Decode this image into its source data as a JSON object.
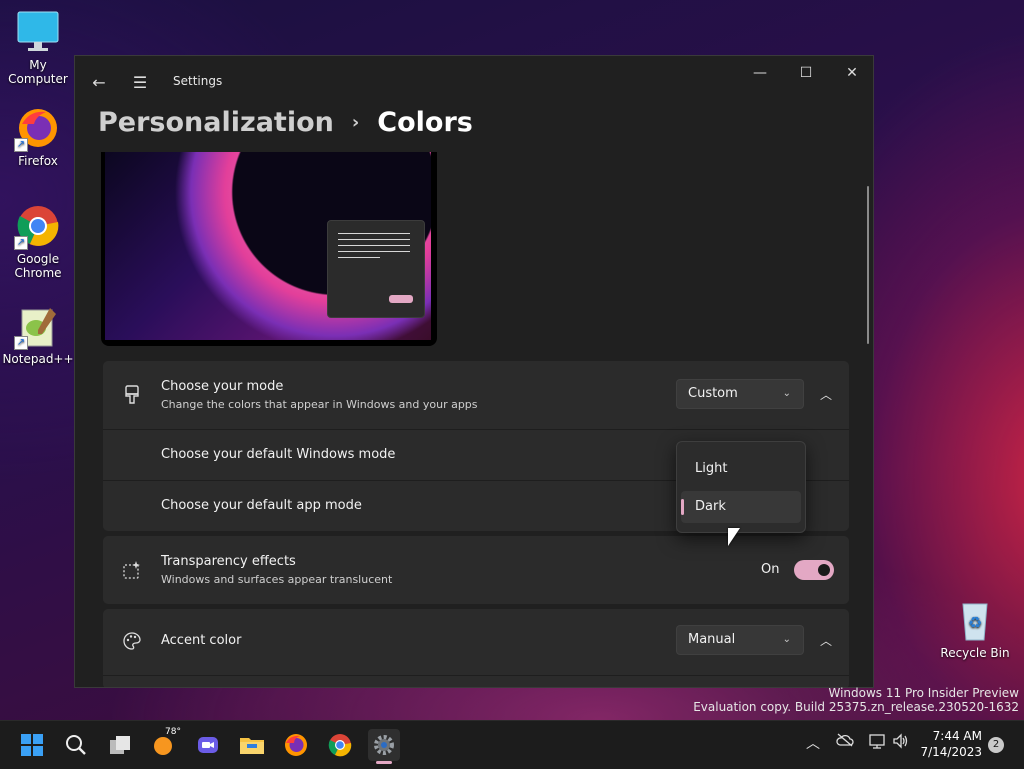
{
  "desktop": {
    "icons": [
      {
        "label": "My Computer"
      },
      {
        "label": "Firefox"
      },
      {
        "label": "Google Chrome"
      },
      {
        "label": "Notepad++"
      },
      {
        "label": "Recycle Bin"
      }
    ]
  },
  "window": {
    "title": "Settings",
    "breadcrumb": {
      "parent": "Personalization",
      "separator": "›",
      "current": "Colors"
    }
  },
  "mode_card": {
    "title": "Choose your mode",
    "subtitle": "Change the colors that appear in Windows and your apps",
    "value": "Custom",
    "windows_mode_label": "Choose your default Windows mode",
    "app_mode_label": "Choose your default app mode"
  },
  "mode_popup": {
    "options": [
      "Light",
      "Dark"
    ],
    "selected": "Dark"
  },
  "transparency": {
    "title": "Transparency effects",
    "subtitle": "Windows and surfaces appear translucent",
    "state_label": "On"
  },
  "accent": {
    "title": "Accent color",
    "value": "Manual"
  },
  "watermark": {
    "line1": "Windows 11 Pro Insider Preview",
    "line2": "Evaluation copy. Build 25375.zn_release.230520-1632"
  },
  "taskbar": {
    "weather_temp": "78°",
    "time": "7:44 AM",
    "date": "7/14/2023",
    "notification_count": "2"
  },
  "colors": {
    "accent": "#e3a8c4",
    "window_bg": "#202020",
    "card_bg": "#2b2b2b"
  }
}
